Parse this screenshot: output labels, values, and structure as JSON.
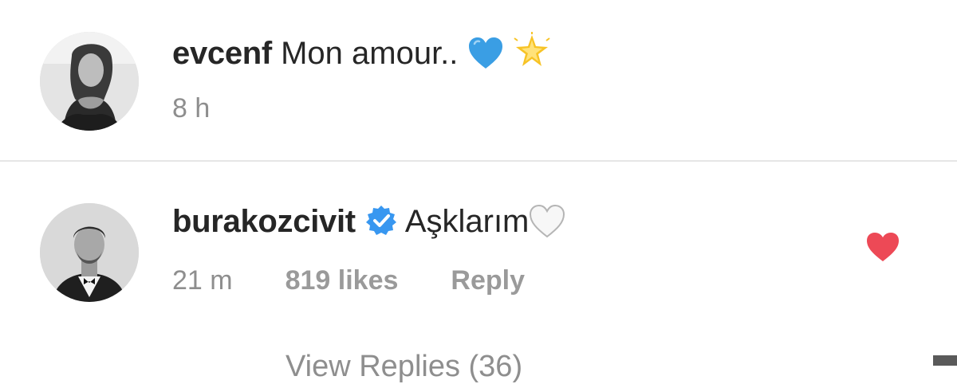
{
  "comments": [
    {
      "username": "evcenf",
      "text": "Mon amour..",
      "emojis": [
        "blue-heart",
        "glowing-star"
      ],
      "time": "8 h",
      "verified": false
    },
    {
      "username": "burakozcivit",
      "text": "Aşklarım",
      "emojis": [
        "white-heart"
      ],
      "time": "21 m",
      "likes": "819 likes",
      "reply_label": "Reply",
      "verified": true,
      "liked": true
    }
  ],
  "view_replies": "View Replies (36)",
  "colors": {
    "text": "#262626",
    "muted": "#8e8e8e",
    "verified": "#3897f0",
    "like_heart": "#ed4956",
    "blue_heart": "#3a9ee4",
    "star": "#f7c325"
  }
}
